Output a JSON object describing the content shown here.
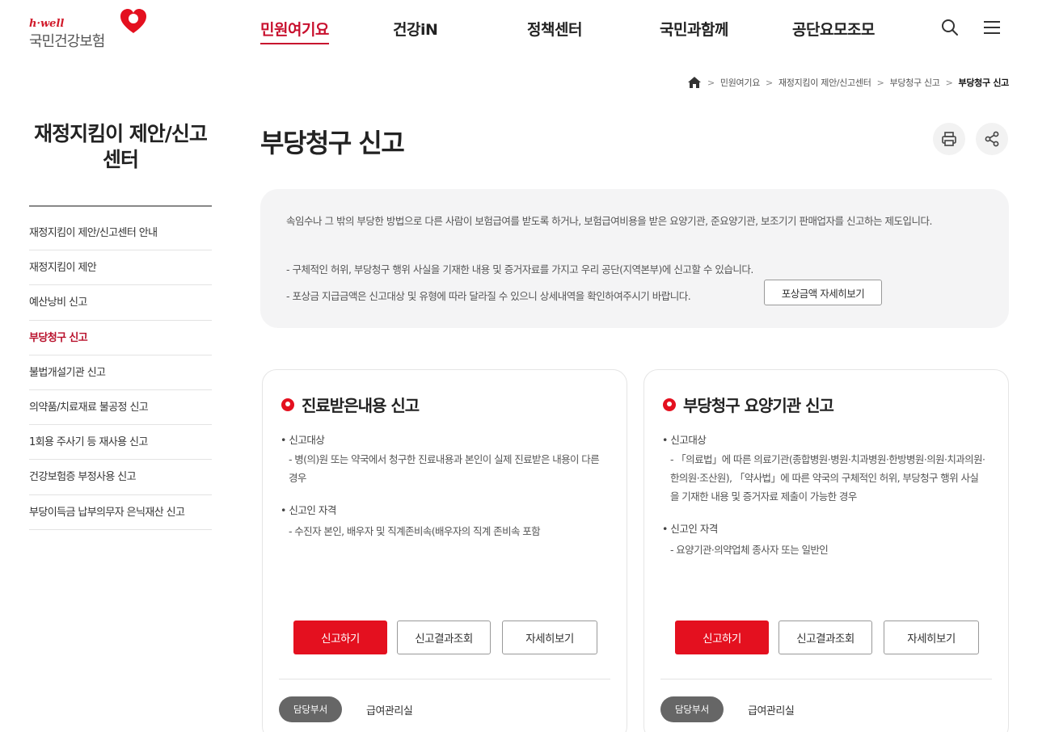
{
  "header": {
    "logo_tagline": "h·well",
    "logo_name": "국민건강보험",
    "nav": [
      "민원여기요",
      "건강iN",
      "정책센터",
      "국민과함께",
      "공단요모조모"
    ],
    "active_nav": "민원여기요"
  },
  "breadcrumb": [
    "민원여기요",
    "재정지킴이 제안/신고센터",
    "부당청구 신고",
    "부당청구 신고"
  ],
  "sidebar": {
    "title": "재정지킴이 제안/신고센터",
    "items": [
      "재정지킴이 제안/신고센터 안내",
      "재정지킴이 제안",
      "예산낭비 신고",
      "부당청구 신고",
      "불법개설기관 신고",
      "의약품/치료재료 불공정 신고",
      "1회용 주사기 등 재사용 신고",
      "건강보험증 부정사용 신고",
      "부당이득금 납부의무자 은닉재산 신고"
    ],
    "active_item": "부당청구 신고"
  },
  "page": {
    "title": "부당청구 신고"
  },
  "info": {
    "main": "속임수나 그 밖의 부당한 방법으로 다른 사람이 보험급여를 받도록 하거나, 보험급여비용을 받은 요양기관, 준요양기관, 보조기기 판매업자를 신고하는 제도입니다.",
    "bullet1": "- 구체적인 허위, 부당청구 행위 사실을 기재한 내용 및 증거자료를 가지고 우리 공단(지역본부)에 신고할 수 있습니다.",
    "bullet2": "- 포상금 지급금액은 신고대상 및 유형에 따라 달라질 수 있으니 상세내역을 확인하여주시기 바랍니다.",
    "button": "포상금액 자세히보기"
  },
  "cards": [
    {
      "title": "진료받은내용 신고",
      "target_label": "• 신고대상",
      "target_desc": "- 병(의)원 또는 약국에서 청구한 진료내용과 본인이 실제 진료받은 내용이 다른 경우",
      "qual_label": "• 신고인 자격",
      "qual_desc": "- 수진자 본인, 배우자 및 직계존비속(배우자의 직계 존비속 포함",
      "btn_report": "신고하기",
      "btn_result": "신고결과조회",
      "btn_detail": "자세히보기",
      "dept_label": "담당부서",
      "dept_name": "급여관리실"
    },
    {
      "title": "부당청구 요양기관 신고",
      "target_label": "• 신고대상",
      "target_desc": "- 「의료법」에 따른 의료기관(종합병원·병원·치과병원·한방병원·의원·치과의원·한의원·조산원), 「약사법」에 따른 약국의 구체적인 허위, 부당청구 행위 사실을 기재한 내용 및 증거자료 제출이 가능한 경우",
      "qual_label": "• 신고인 자격",
      "qual_desc": "- 요양기관·의약업체 종사자 또는 일반인",
      "btn_report": "신고하기",
      "btn_result": "신고결과조회",
      "btn_detail": "자세히보기",
      "dept_label": "담당부서",
      "dept_name": "급여관리실"
    }
  ],
  "colors": {
    "brand_red": "#e4101f",
    "active_red": "#c8102e",
    "info_bg": "#f4f4f5"
  }
}
